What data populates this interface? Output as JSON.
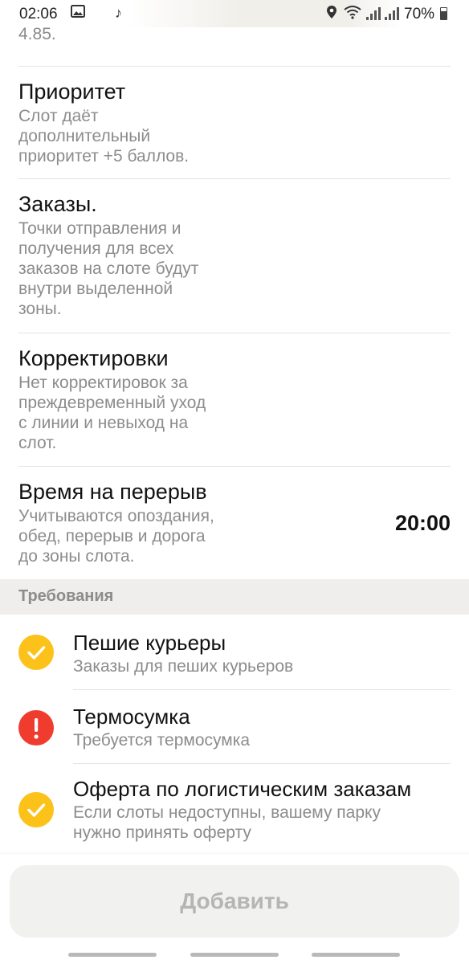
{
  "status_bar": {
    "time": "02:06",
    "battery": "70%",
    "icons": [
      "image-icon",
      "music-note-icon",
      "location-icon",
      "wifi-icon",
      "signal-icon",
      "battery-icon"
    ]
  },
  "top_cut": {
    "value": "4.85."
  },
  "sections": [
    {
      "title": "Приоритет",
      "desc_lines": [
        "Слот даёт",
        "дополнительный",
        "приоритет +5 баллов."
      ]
    },
    {
      "title": "Заказы.",
      "desc_lines": [
        "Точки отправления и",
        "получения для всех",
        "заказов на слоте будут",
        "внутри выделенной",
        "зоны."
      ]
    },
    {
      "title": "Корректировки",
      "desc_lines": [
        "Нет корректировок за",
        "преждевременный уход",
        "с линии и невыход на",
        "слот."
      ]
    },
    {
      "title": "Время на перерыв",
      "desc_lines": [
        "Учитываются опоздания,",
        "обед, перерыв и дорога",
        "до зоны слота."
      ],
      "value": "20:00"
    }
  ],
  "requirements": {
    "header": "Требования",
    "items": [
      {
        "title": "Пешие курьеры",
        "desc_lines": [
          "Заказы для пеших курьеров"
        ],
        "status": "ok"
      },
      {
        "title": "Термосумка",
        "desc_lines": [
          "Требуется термосумка"
        ],
        "status": "warn"
      },
      {
        "title": "Оферта по логистическим заказам",
        "desc_lines": [
          "Если слоты недоступны, вашему парку",
          "нужно принять оферту"
        ],
        "status": "ok"
      }
    ]
  },
  "add_button": {
    "label": "Добавить"
  },
  "colors": {
    "ok": "#fcc21a",
    "warn": "#f03c2e",
    "muted_text": "#8c8c8c",
    "header_bg": "#efeeec"
  }
}
